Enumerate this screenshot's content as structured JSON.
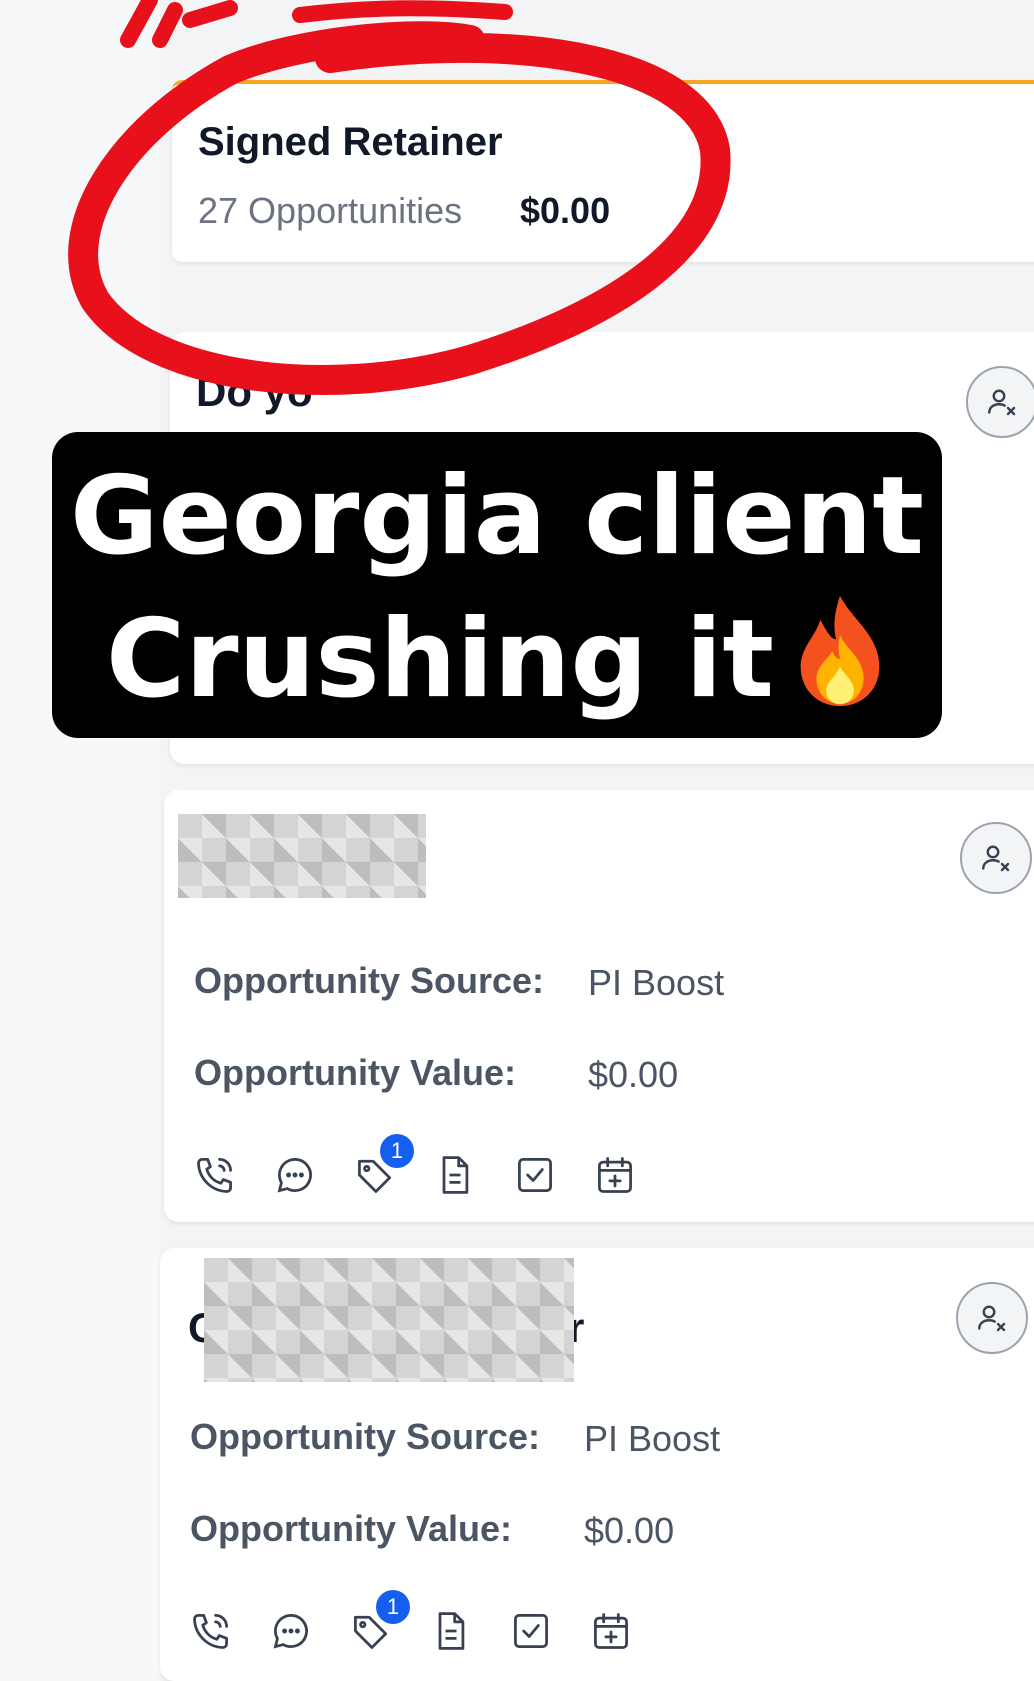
{
  "stage": {
    "title": "Signed Retainer",
    "count_label": "27 Opportunities",
    "total_value": "$0.00"
  },
  "cards": [
    {
      "name_visible": "Do       yo",
      "name_redacted": true
    },
    {
      "name_redacted": true,
      "source_label": "Opportunity Source:",
      "source_value": "PI Boost",
      "value_label": "Opportunity Value:",
      "value_value": "$0.00",
      "tag_badge": "1"
    },
    {
      "name_prefix": "C",
      "name_suffix": "r",
      "name_redacted": true,
      "source_label": "Opportunity Source:",
      "source_value": "PI Boost",
      "value_label": "Opportunity Value:",
      "value_value": "$0.00",
      "tag_badge": "1"
    }
  ],
  "overlay": {
    "line1": "Georgia client",
    "line2": "Crushing it"
  },
  "icons": {
    "assign": "user-x-icon",
    "actions": [
      "phone-icon",
      "chat-icon",
      "tag-icon",
      "note-icon",
      "task-icon",
      "calendar-add-icon"
    ],
    "flame": "fire-emoji"
  },
  "colors": {
    "stage_accent": "#f5a623",
    "badge": "#155eef",
    "annotation_red": "#e8101a",
    "overlay_bg": "#000000"
  }
}
